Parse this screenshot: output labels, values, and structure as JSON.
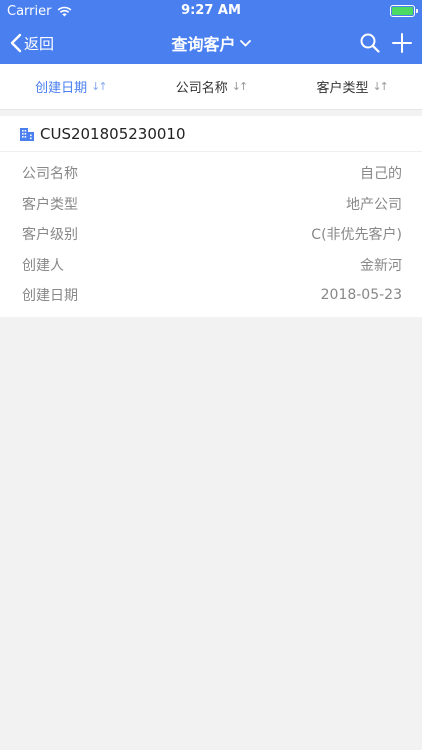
{
  "status": {
    "carrier": "Carrier",
    "time": "9:27 AM"
  },
  "nav": {
    "back_label": "返回",
    "title": "查询客户"
  },
  "sort": {
    "items": [
      {
        "label": "创建日期",
        "active": true
      },
      {
        "label": "公司名称",
        "active": false
      },
      {
        "label": "客户类型",
        "active": false
      }
    ]
  },
  "customer": {
    "id": "CUS201805230010",
    "fields": [
      {
        "label": "公司名称",
        "value": "自己的"
      },
      {
        "label": "客户类型",
        "value": "地产公司"
      },
      {
        "label": "客户级别",
        "value": "C(非优先客户)"
      },
      {
        "label": "创建人",
        "value": "金新河"
      },
      {
        "label": "创建日期",
        "value": "2018-05-23"
      }
    ]
  },
  "colors": {
    "accent": "#4a7ff0",
    "battery": "#4cd964"
  }
}
